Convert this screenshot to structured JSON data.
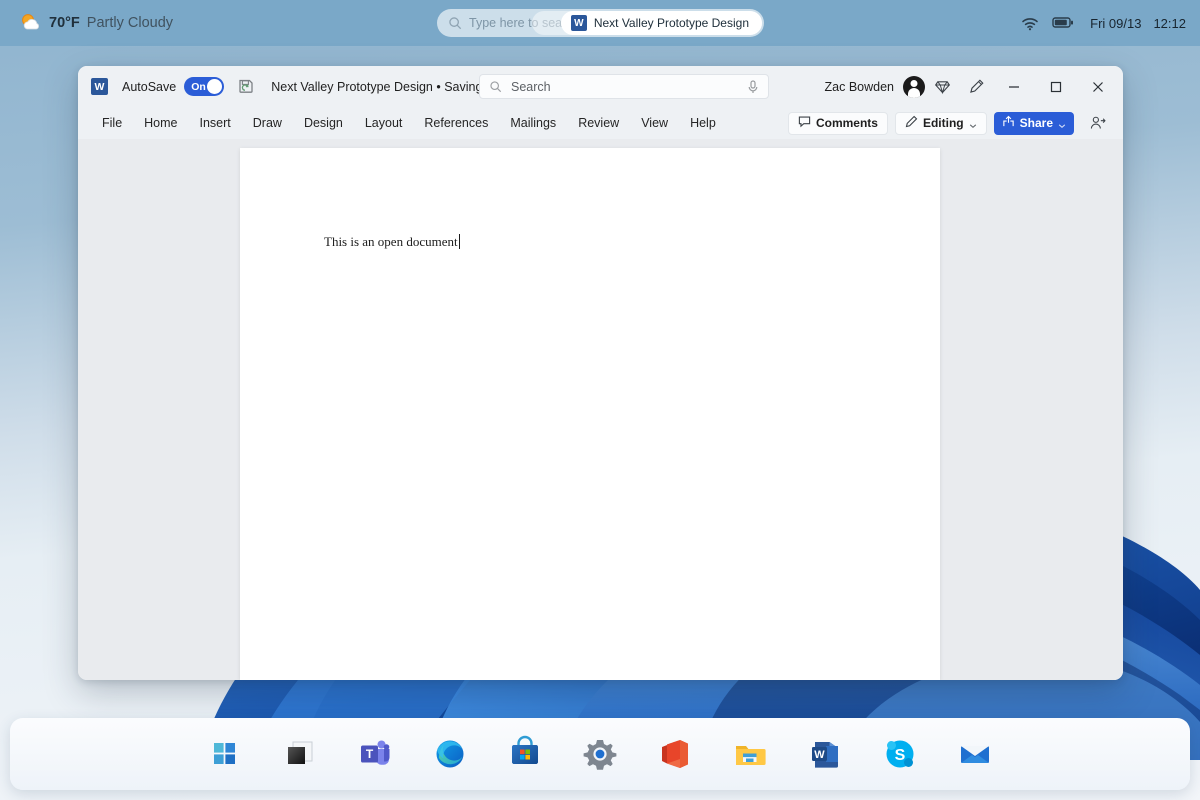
{
  "desktop": {
    "wallpaper_name": "windows-11-bloom-wallpaper",
    "accent_color": "#2b5dd7",
    "topbar_color": "#7aa8c8"
  },
  "topbar": {
    "weather": {
      "icon": "partly-cloudy-icon",
      "temperature": "70°F",
      "condition": "Partly Cloudy"
    },
    "search": {
      "icon": "search-icon",
      "placeholder": "Type here to search",
      "pill": {
        "icon": "word-app-icon",
        "label": "Next Valley Prototype Design"
      }
    },
    "tray": {
      "wifi_icon": "wifi-icon",
      "battery_icon": "battery-icon",
      "date": "Fri 09/13",
      "time": "12:12"
    }
  },
  "word": {
    "titlebar": {
      "app_icon": "word-app-icon",
      "autosave_label": "AutoSave",
      "autosave_state": "On",
      "save_icon": "save-sync-icon",
      "document_title": "Next Valley Prototype Design • Saving...",
      "title_chevron": "chevron-down-icon",
      "search": {
        "icon": "search-icon",
        "placeholder": "Search",
        "mic_icon": "microphone-icon"
      },
      "user_name": "Zac Bowden",
      "avatar": "user-avatar",
      "diamond_icon": "diamond-icon",
      "pen_icon": "pen-icon",
      "minimize_icon": "minimize-icon",
      "maximize_icon": "maximize-icon",
      "close_icon": "close-icon"
    },
    "ribbon": {
      "tabs": [
        {
          "label": "File"
        },
        {
          "label": "Home"
        },
        {
          "label": "Insert"
        },
        {
          "label": "Draw"
        },
        {
          "label": "Design"
        },
        {
          "label": "Layout"
        },
        {
          "label": "References"
        },
        {
          "label": "Mailings"
        },
        {
          "label": "Review"
        },
        {
          "label": "View"
        },
        {
          "label": "Help"
        }
      ],
      "comments_label": "Comments",
      "comments_icon": "comment-bubble-icon",
      "editing_label": "Editing",
      "editing_icon": "pencil-icon",
      "editing_chevron": "chevron-down-icon",
      "share_label": "Share",
      "share_icon": "share-icon",
      "share_chevron": "chevron-down-icon",
      "collab_icon": "person-add-icon"
    },
    "document": {
      "body_text": "This is an open document"
    }
  },
  "taskbar": {
    "items": [
      {
        "name": "start-button",
        "icon": "windows-logo-icon"
      },
      {
        "name": "task-view-button",
        "icon": "task-view-icon"
      },
      {
        "name": "teams-button",
        "icon": "microsoft-teams-icon"
      },
      {
        "name": "edge-button",
        "icon": "microsoft-edge-icon"
      },
      {
        "name": "store-button",
        "icon": "microsoft-store-icon"
      },
      {
        "name": "settings-button",
        "icon": "settings-gear-icon"
      },
      {
        "name": "office-button",
        "icon": "microsoft-office-icon"
      },
      {
        "name": "file-explorer-button",
        "icon": "file-explorer-icon"
      },
      {
        "name": "word-button",
        "icon": "microsoft-word-icon"
      },
      {
        "name": "skype-button",
        "icon": "skype-icon"
      },
      {
        "name": "mail-button",
        "icon": "mail-icon"
      }
    ]
  }
}
